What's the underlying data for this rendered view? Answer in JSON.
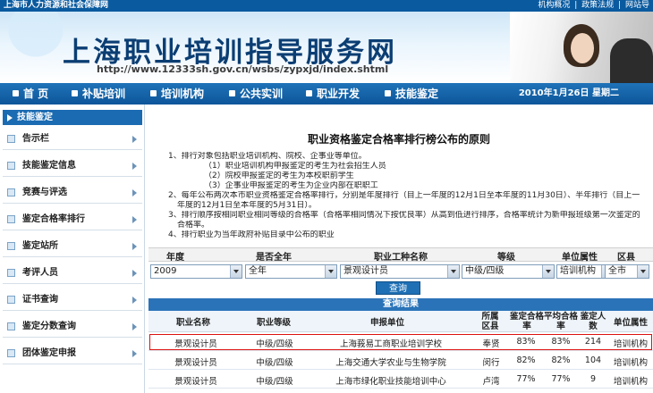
{
  "topbar": {
    "site": "上海市人力资源和社会保障网",
    "links": [
      "机构概况",
      "|",
      "政策法规",
      "|",
      "网站导"
    ]
  },
  "banner": {
    "title": "上海职业培训指导服务网",
    "url": "http://www.12333sh.gov.cn/wsbs/zypxjd/index.shtml"
  },
  "nav": {
    "items": [
      "首 页",
      "补贴培训",
      "培训机构",
      "公共实训",
      "职业开发",
      "技能鉴定"
    ],
    "date": "2010年1月26日  星期二"
  },
  "sidebar": {
    "header": "技能鉴定",
    "items": [
      "告示栏",
      "技能鉴定信息",
      "竞赛与评选",
      "鉴定合格率排行",
      "鉴定站所",
      "考评人员",
      "证书查询",
      "鉴定分数查询",
      "团体鉴定申报"
    ]
  },
  "main": {
    "title": "职业资格鉴定合格率排行榜公布的原则",
    "rules": [
      "1、排行对象包括职业培训机构、院校、企事业等单位。",
      "（1）职业培训机构申报鉴定的考生为社会招生人员",
      "（2）院校申报鉴定的考生为本校职前学生",
      "（3）企事业申报鉴定的考生为企业内部在职职工",
      "2、每年公布两次本市职业资格鉴定合格率排行，分别是年度排行（目上一年度的12月1日至本年度的11月30日）、半年排行（目上一",
      "年度的12月1日至本年度的5月31日）。",
      "3、排行顺序按相同职业相同等级的合格率（合格率相同情况下按优良率）从高到低进行排序，合格率统计为新申报班级第一次鉴定的",
      "合格率。",
      "4、排行职业为当年政府补贴目录中公布的职业"
    ]
  },
  "filters": {
    "labels": [
      "年度",
      "是否全年",
      "职业工种名称",
      "等级",
      "单位属性",
      "区县"
    ],
    "values": [
      "2009",
      "全年",
      "景观设计员",
      "中级/四级",
      "培训机构",
      "全市"
    ],
    "query_label": "查询"
  },
  "results": {
    "title": "查询结果",
    "headers": [
      "职业名称",
      "职业等级",
      "申报单位",
      "所属区县",
      "鉴定合格率",
      "平均合格率",
      "鉴定人数",
      "单位属性"
    ],
    "rows": [
      [
        "景观设计员",
        "中级/四级",
        "上海莪易工商职业培训学校",
        "奉贤",
        "83%",
        "83%",
        "214",
        "培训机构"
      ],
      [
        "景观设计员",
        "中级/四级",
        "上海交通大学农业与生物学院",
        "闵行",
        "82%",
        "82%",
        "104",
        "培训机构"
      ],
      [
        "景观设计员",
        "中级/四级",
        "上海市绿化职业技能培训中心",
        "卢湾",
        "77%",
        "77%",
        "9",
        "培训机构"
      ]
    ]
  }
}
